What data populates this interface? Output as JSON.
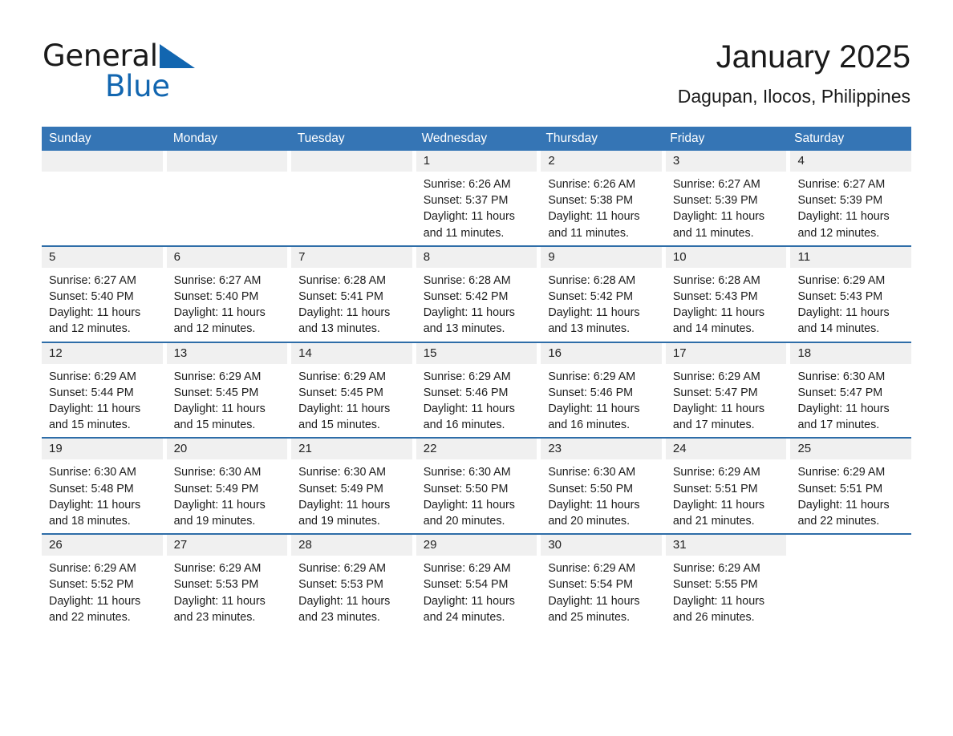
{
  "logo": {
    "text_primary": "General",
    "text_secondary": "Blue",
    "triangle_color": "#1266b0"
  },
  "header": {
    "title": "January 2025",
    "subtitle": "Dagupan, Ilocos, Philippines"
  },
  "theme": {
    "header_bg": "#3575b5",
    "header_text": "#ffffff",
    "row_rule": "#2e6da8",
    "daynum_bg": "#f0f0f0",
    "page_bg": "#ffffff"
  },
  "weekdays": [
    "Sunday",
    "Monday",
    "Tuesday",
    "Wednesday",
    "Thursday",
    "Friday",
    "Saturday"
  ],
  "weeks": [
    [
      {
        "day": "",
        "sunrise": "",
        "sunset": "",
        "daylight1": "",
        "daylight2": "",
        "state": "blank"
      },
      {
        "day": "",
        "sunrise": "",
        "sunset": "",
        "daylight1": "",
        "daylight2": "",
        "state": "blank"
      },
      {
        "day": "",
        "sunrise": "",
        "sunset": "",
        "daylight1": "",
        "daylight2": "",
        "state": "blank"
      },
      {
        "day": "1",
        "sunrise": "Sunrise: 6:26 AM",
        "sunset": "Sunset: 5:37 PM",
        "daylight1": "Daylight: 11 hours",
        "daylight2": "and 11 minutes.",
        "state": "filled"
      },
      {
        "day": "2",
        "sunrise": "Sunrise: 6:26 AM",
        "sunset": "Sunset: 5:38 PM",
        "daylight1": "Daylight: 11 hours",
        "daylight2": "and 11 minutes.",
        "state": "filled"
      },
      {
        "day": "3",
        "sunrise": "Sunrise: 6:27 AM",
        "sunset": "Sunset: 5:39 PM",
        "daylight1": "Daylight: 11 hours",
        "daylight2": "and 11 minutes.",
        "state": "filled"
      },
      {
        "day": "4",
        "sunrise": "Sunrise: 6:27 AM",
        "sunset": "Sunset: 5:39 PM",
        "daylight1": "Daylight: 11 hours",
        "daylight2": "and 12 minutes.",
        "state": "filled"
      }
    ],
    [
      {
        "day": "5",
        "sunrise": "Sunrise: 6:27 AM",
        "sunset": "Sunset: 5:40 PM",
        "daylight1": "Daylight: 11 hours",
        "daylight2": "and 12 minutes.",
        "state": "filled"
      },
      {
        "day": "6",
        "sunrise": "Sunrise: 6:27 AM",
        "sunset": "Sunset: 5:40 PM",
        "daylight1": "Daylight: 11 hours",
        "daylight2": "and 12 minutes.",
        "state": "filled"
      },
      {
        "day": "7",
        "sunrise": "Sunrise: 6:28 AM",
        "sunset": "Sunset: 5:41 PM",
        "daylight1": "Daylight: 11 hours",
        "daylight2": "and 13 minutes.",
        "state": "filled"
      },
      {
        "day": "8",
        "sunrise": "Sunrise: 6:28 AM",
        "sunset": "Sunset: 5:42 PM",
        "daylight1": "Daylight: 11 hours",
        "daylight2": "and 13 minutes.",
        "state": "filled"
      },
      {
        "day": "9",
        "sunrise": "Sunrise: 6:28 AM",
        "sunset": "Sunset: 5:42 PM",
        "daylight1": "Daylight: 11 hours",
        "daylight2": "and 13 minutes.",
        "state": "filled"
      },
      {
        "day": "10",
        "sunrise": "Sunrise: 6:28 AM",
        "sunset": "Sunset: 5:43 PM",
        "daylight1": "Daylight: 11 hours",
        "daylight2": "and 14 minutes.",
        "state": "filled"
      },
      {
        "day": "11",
        "sunrise": "Sunrise: 6:29 AM",
        "sunset": "Sunset: 5:43 PM",
        "daylight1": "Daylight: 11 hours",
        "daylight2": "and 14 minutes.",
        "state": "filled"
      }
    ],
    [
      {
        "day": "12",
        "sunrise": "Sunrise: 6:29 AM",
        "sunset": "Sunset: 5:44 PM",
        "daylight1": "Daylight: 11 hours",
        "daylight2": "and 15 minutes.",
        "state": "filled"
      },
      {
        "day": "13",
        "sunrise": "Sunrise: 6:29 AM",
        "sunset": "Sunset: 5:45 PM",
        "daylight1": "Daylight: 11 hours",
        "daylight2": "and 15 minutes.",
        "state": "filled"
      },
      {
        "day": "14",
        "sunrise": "Sunrise: 6:29 AM",
        "sunset": "Sunset: 5:45 PM",
        "daylight1": "Daylight: 11 hours",
        "daylight2": "and 15 minutes.",
        "state": "filled"
      },
      {
        "day": "15",
        "sunrise": "Sunrise: 6:29 AM",
        "sunset": "Sunset: 5:46 PM",
        "daylight1": "Daylight: 11 hours",
        "daylight2": "and 16 minutes.",
        "state": "filled"
      },
      {
        "day": "16",
        "sunrise": "Sunrise: 6:29 AM",
        "sunset": "Sunset: 5:46 PM",
        "daylight1": "Daylight: 11 hours",
        "daylight2": "and 16 minutes.",
        "state": "filled"
      },
      {
        "day": "17",
        "sunrise": "Sunrise: 6:29 AM",
        "sunset": "Sunset: 5:47 PM",
        "daylight1": "Daylight: 11 hours",
        "daylight2": "and 17 minutes.",
        "state": "filled"
      },
      {
        "day": "18",
        "sunrise": "Sunrise: 6:30 AM",
        "sunset": "Sunset: 5:47 PM",
        "daylight1": "Daylight: 11 hours",
        "daylight2": "and 17 minutes.",
        "state": "filled"
      }
    ],
    [
      {
        "day": "19",
        "sunrise": "Sunrise: 6:30 AM",
        "sunset": "Sunset: 5:48 PM",
        "daylight1": "Daylight: 11 hours",
        "daylight2": "and 18 minutes.",
        "state": "filled"
      },
      {
        "day": "20",
        "sunrise": "Sunrise: 6:30 AM",
        "sunset": "Sunset: 5:49 PM",
        "daylight1": "Daylight: 11 hours",
        "daylight2": "and 19 minutes.",
        "state": "filled"
      },
      {
        "day": "21",
        "sunrise": "Sunrise: 6:30 AM",
        "sunset": "Sunset: 5:49 PM",
        "daylight1": "Daylight: 11 hours",
        "daylight2": "and 19 minutes.",
        "state": "filled"
      },
      {
        "day": "22",
        "sunrise": "Sunrise: 6:30 AM",
        "sunset": "Sunset: 5:50 PM",
        "daylight1": "Daylight: 11 hours",
        "daylight2": "and 20 minutes.",
        "state": "filled"
      },
      {
        "day": "23",
        "sunrise": "Sunrise: 6:30 AM",
        "sunset": "Sunset: 5:50 PM",
        "daylight1": "Daylight: 11 hours",
        "daylight2": "and 20 minutes.",
        "state": "filled"
      },
      {
        "day": "24",
        "sunrise": "Sunrise: 6:29 AM",
        "sunset": "Sunset: 5:51 PM",
        "daylight1": "Daylight: 11 hours",
        "daylight2": "and 21 minutes.",
        "state": "filled"
      },
      {
        "day": "25",
        "sunrise": "Sunrise: 6:29 AM",
        "sunset": "Sunset: 5:51 PM",
        "daylight1": "Daylight: 11 hours",
        "daylight2": "and 22 minutes.",
        "state": "filled"
      }
    ],
    [
      {
        "day": "26",
        "sunrise": "Sunrise: 6:29 AM",
        "sunset": "Sunset: 5:52 PM",
        "daylight1": "Daylight: 11 hours",
        "daylight2": "and 22 minutes.",
        "state": "filled"
      },
      {
        "day": "27",
        "sunrise": "Sunrise: 6:29 AM",
        "sunset": "Sunset: 5:53 PM",
        "daylight1": "Daylight: 11 hours",
        "daylight2": "and 23 minutes.",
        "state": "filled"
      },
      {
        "day": "28",
        "sunrise": "Sunrise: 6:29 AM",
        "sunset": "Sunset: 5:53 PM",
        "daylight1": "Daylight: 11 hours",
        "daylight2": "and 23 minutes.",
        "state": "filled"
      },
      {
        "day": "29",
        "sunrise": "Sunrise: 6:29 AM",
        "sunset": "Sunset: 5:54 PM",
        "daylight1": "Daylight: 11 hours",
        "daylight2": "and 24 minutes.",
        "state": "filled"
      },
      {
        "day": "30",
        "sunrise": "Sunrise: 6:29 AM",
        "sunset": "Sunset: 5:54 PM",
        "daylight1": "Daylight: 11 hours",
        "daylight2": "and 25 minutes.",
        "state": "filled"
      },
      {
        "day": "31",
        "sunrise": "Sunrise: 6:29 AM",
        "sunset": "Sunset: 5:55 PM",
        "daylight1": "Daylight: 11 hours",
        "daylight2": "and 26 minutes.",
        "state": "filled"
      },
      {
        "day": "",
        "sunrise": "",
        "sunset": "",
        "daylight1": "",
        "daylight2": "",
        "state": "void"
      }
    ]
  ]
}
